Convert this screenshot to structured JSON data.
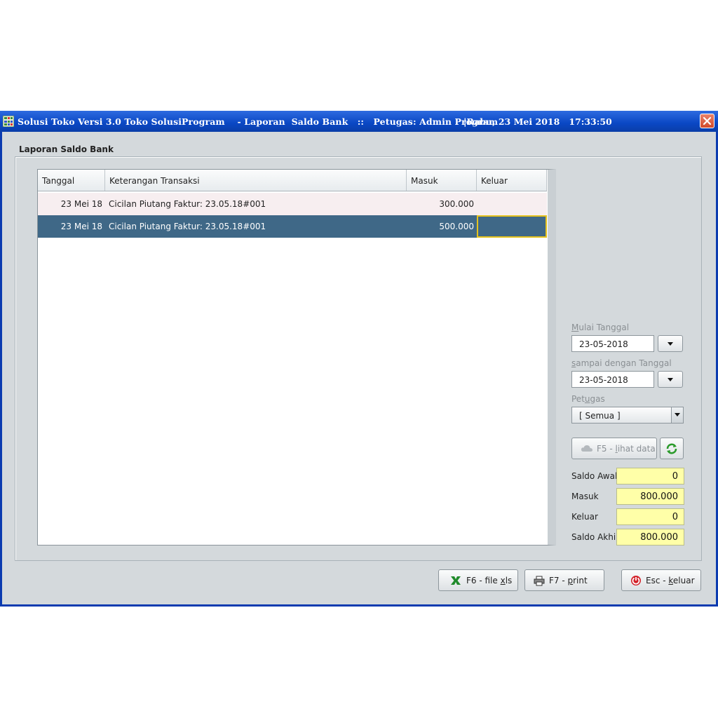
{
  "window": {
    "title": "Solusi Toko Versi 3.0 Toko SolusiProgram    - Laporan  Saldo Bank   ::   Petugas: Admin Program",
    "datetime": "|Rabu, 23 Mei 2018   17:33:50"
  },
  "panel": {
    "caption": "Laporan  Saldo Bank"
  },
  "table": {
    "columns": [
      "Tanggal",
      "Keterangan Transaksi",
      "Masuk",
      "Keluar"
    ],
    "rows": [
      {
        "tanggal": "23 Mei 18",
        "keterangan": "Cicilan Piutang Faktur: 23.05.18#001",
        "masuk": "300.000",
        "keluar": ""
      },
      {
        "tanggal": "23 Mei 18",
        "keterangan": "Cicilan Piutang Faktur: 23.05.18#001",
        "masuk": "500.000",
        "keluar": ""
      }
    ]
  },
  "filters": {
    "mulai_label_u": "M",
    "mulai_label_rest": "ulai Tanggal",
    "mulai_value": "23-05-2018",
    "sampai_label_u": "s",
    "sampai_label_rest": "ampai dengan Tanggal",
    "sampai_value": "23-05-2018",
    "petugas_label_pre": "Pet",
    "petugas_label_u": "u",
    "petugas_label_rest": "gas",
    "petugas_value": "[ Semua ]"
  },
  "buttons": {
    "lihat_pre": "F5 - ",
    "lihat_u": "l",
    "lihat_rest": "ihat data",
    "xls_pre": "F6 - file ",
    "xls_u": "x",
    "xls_rest": "ls",
    "print_pre": "F7 - ",
    "print_u": "p",
    "print_rest": "rint",
    "keluar_pre": "Esc - ",
    "keluar_u": "k",
    "keluar_rest": "eluar"
  },
  "summary": {
    "saldo_awal_label": "Saldo Awal",
    "saldo_awal": "0",
    "masuk_label": "Masuk",
    "masuk": "800.000",
    "keluar_label": "Keluar",
    "keluar": "0",
    "saldo_akhir_label": "Saldo Akhir",
    "saldo_akhir": "800.000"
  },
  "colors": {
    "titlebar": "#0a47c4",
    "selected_row": "#3f6887",
    "summary_bg": "#ffffa8",
    "focus_border": "#e5c21d"
  },
  "icons": [
    "app-grid-icon",
    "close-icon",
    "dropdown-arrow-icon",
    "cloud-icon",
    "refresh-icon",
    "excel-icon",
    "printer-icon",
    "exit-icon"
  ]
}
